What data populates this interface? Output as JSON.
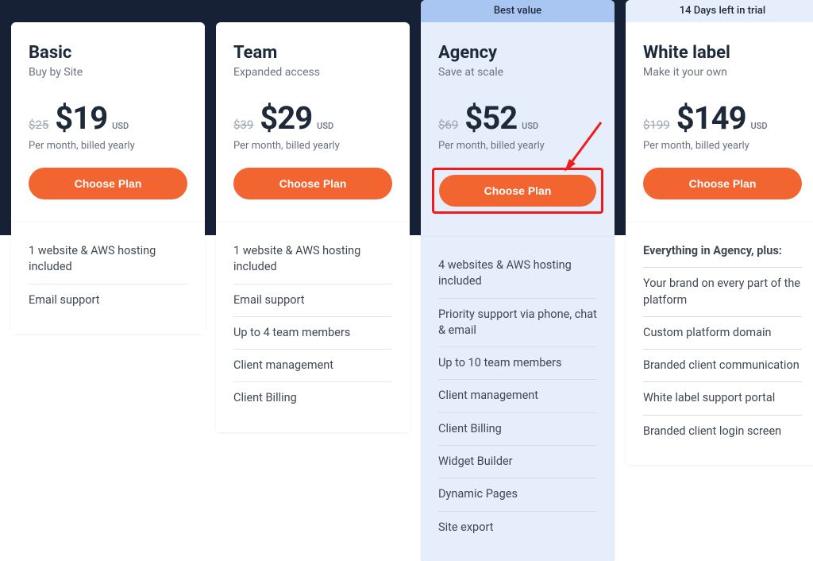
{
  "common": {
    "currency": "USD",
    "billing_cycle": "Per month, billed yearly",
    "cta": "Choose Plan"
  },
  "badges": {
    "best": "Best value",
    "trial": "14 Days left in trial"
  },
  "plans": [
    {
      "name": "Basic",
      "tagline": "Buy by Site",
      "old_price": "$25",
      "price": "$19",
      "features": [
        "1 website & AWS hosting included",
        "Email support"
      ]
    },
    {
      "name": "Team",
      "tagline": "Expanded access",
      "old_price": "$39",
      "price": "$29",
      "features": [
        "1 website & AWS hosting included",
        "Email support",
        "Up to 4 team members",
        "Client management",
        "Client Billing"
      ]
    },
    {
      "name": "Agency",
      "tagline": "Save at scale",
      "old_price": "$69",
      "price": "$52",
      "features": [
        "4 websites & AWS hosting included",
        "Priority support via phone, chat & email",
        "Up to 10 team members",
        "Client management",
        "Client Billing",
        "Widget Builder",
        "Dynamic Pages",
        "Site export"
      ]
    },
    {
      "name": "White label",
      "tagline": "Make it your own",
      "old_price": "$199",
      "price": "$149",
      "features_heading": "Everything in Agency, plus:",
      "features": [
        "Your brand on every part of the platform",
        "Custom platform domain",
        "Branded client communication",
        "White label support portal",
        "Branded client login screen"
      ]
    }
  ]
}
